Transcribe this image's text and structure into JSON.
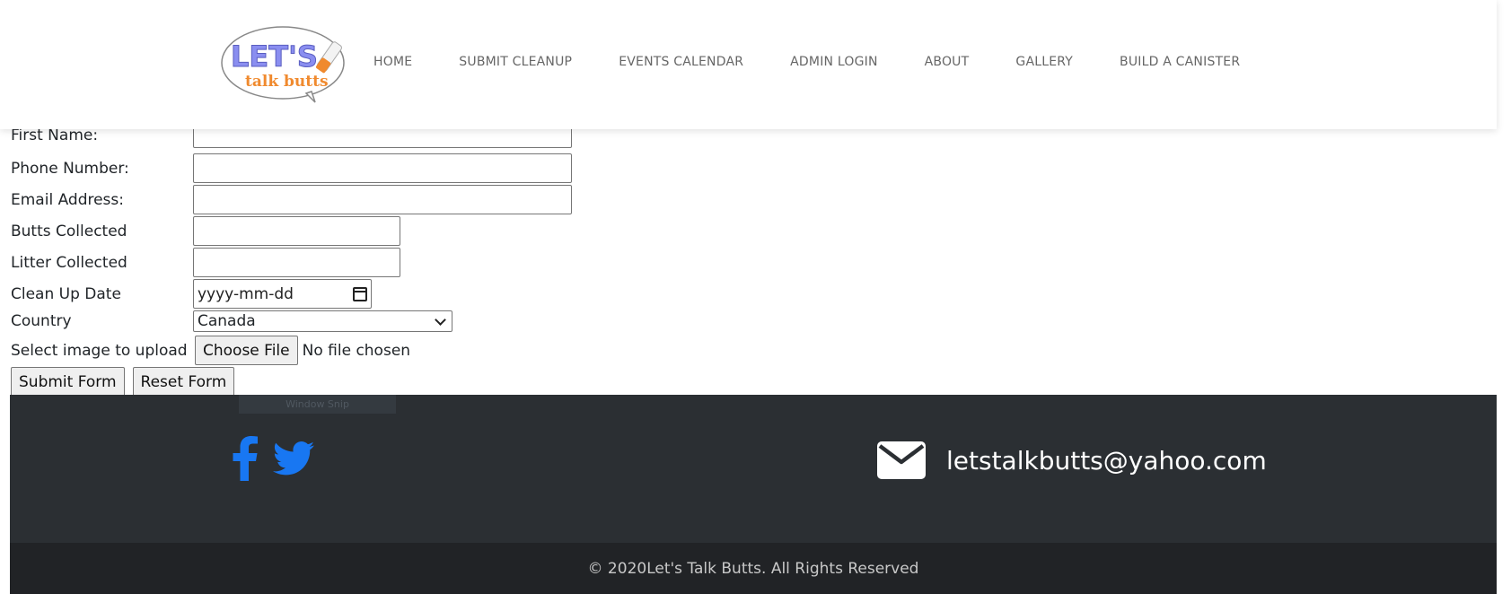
{
  "header": {
    "logo_text_top": "LET'S",
    "logo_text_bottom": "talk butts",
    "nav": [
      "HOME",
      "SUBMIT CLEANUP",
      "EVENTS CALENDAR",
      "ADMIN LOGIN",
      "ABOUT",
      "GALLERY",
      "BUILD A CANISTER"
    ]
  },
  "form": {
    "first_name_label": "First Name:",
    "phone_label": "Phone Number:",
    "email_label": "Email Address:",
    "butts_label": "Butts Collected",
    "litter_label": "Litter Collected",
    "date_label": "Clean Up Date",
    "date_placeholder": "yyyy-mm-dd",
    "country_label": "Country",
    "country_value": "Canada",
    "upload_label": "Select image to upload",
    "choose_file": "Choose File",
    "file_status": "No file chosen",
    "submit": "Submit Form",
    "reset": "Reset Form"
  },
  "footer": {
    "ghost_label": "Window Snip",
    "email": "letstalkbutts@yahoo.com",
    "copyright": "© 2020Let's Talk Butts. All Rights Reserved"
  },
  "colors": {
    "social_blue": "#1877f2",
    "footer_dark": "#2b2f33",
    "footer_darker": "#212326",
    "logo_purple": "#8a8ef0",
    "logo_orange": "#f08a2e"
  }
}
